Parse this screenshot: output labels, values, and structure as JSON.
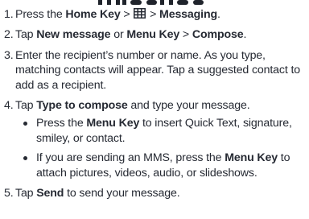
{
  "steps": [
    {
      "number": "1.",
      "segments": [
        {
          "text": "Press the ",
          "bold": false
        },
        {
          "text": "Home Key",
          "bold": true
        },
        {
          "text": " > ",
          "bold": false
        },
        {
          "icon": "app-grid-icon"
        },
        {
          "text": " > ",
          "bold": false
        },
        {
          "text": "Messaging",
          "bold": true
        },
        {
          "text": ".",
          "bold": false
        }
      ]
    },
    {
      "number": "2.",
      "segments": [
        {
          "text": "Tap ",
          "bold": false
        },
        {
          "text": "New message",
          "bold": true
        },
        {
          "text": " or ",
          "bold": false
        },
        {
          "text": "Menu Key",
          "bold": true
        },
        {
          "text": " > ",
          "bold": false
        },
        {
          "text": "Compose",
          "bold": true
        },
        {
          "text": ".",
          "bold": false
        }
      ]
    },
    {
      "number": "3.",
      "segments": [
        {
          "text": "Enter the recipient’s number or name. As you type, matching contacts will appear. Tap a suggested contact to add as a recipient.",
          "bold": false
        }
      ]
    },
    {
      "number": "4.",
      "segments": [
        {
          "text": "Tap ",
          "bold": false
        },
        {
          "text": "Type to compose",
          "bold": true
        },
        {
          "text": " and type your message.",
          "bold": false
        }
      ],
      "sub_items": [
        {
          "segments": [
            {
              "text": "Press the ",
              "bold": false
            },
            {
              "text": "Menu Key",
              "bold": true
            },
            {
              "text": " to insert Quick Text, signature, smiley, or contact.",
              "bold": false
            }
          ]
        },
        {
          "segments": [
            {
              "text": "If you are sending an MMS, press the ",
              "bold": false
            },
            {
              "text": "Menu Key",
              "bold": true
            },
            {
              "text": " to attach pictures, videos, audio, or slideshows.",
              "bold": false
            }
          ]
        }
      ]
    },
    {
      "number": "5.",
      "segments": [
        {
          "text": "Tap ",
          "bold": false
        },
        {
          "text": "Send",
          "bold": true
        },
        {
          "text": " to send your message.",
          "bold": false
        }
      ]
    }
  ]
}
